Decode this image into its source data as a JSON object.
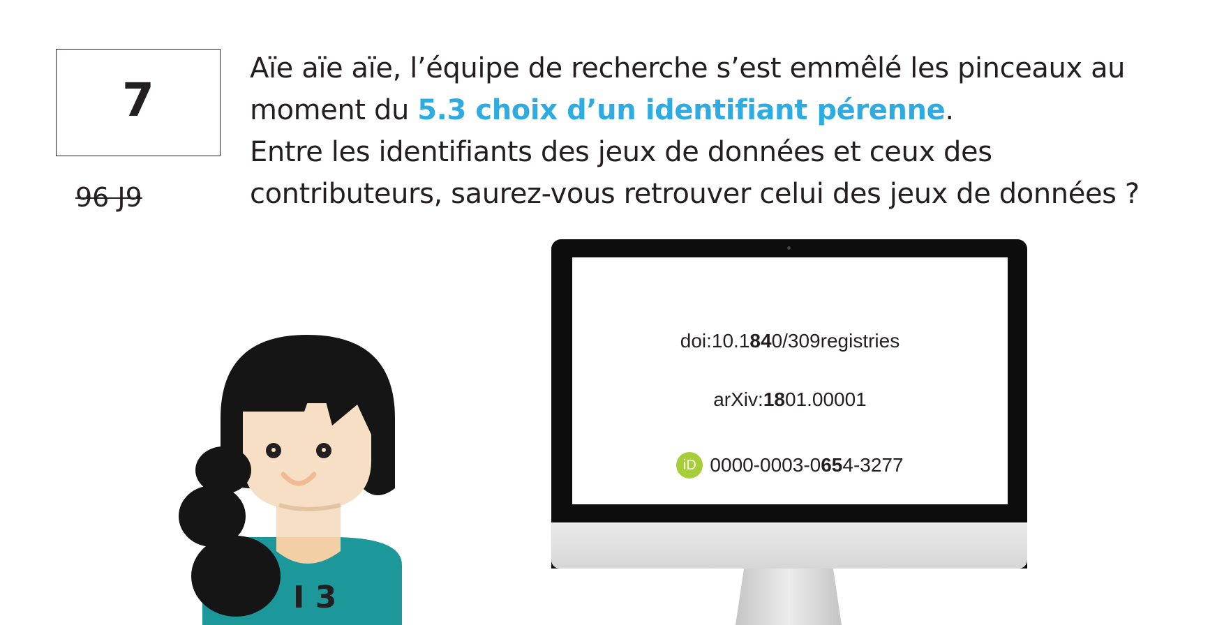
{
  "puzzle": {
    "number": "7",
    "flipped_code": "96 J9"
  },
  "question": {
    "line1": "Aïe aïe aïe, l’équipe de recherche s’est emmêlé les pinceaux au",
    "line2_before": "moment du ",
    "line2_link": "5.3 choix d’un identifiant pérenne",
    "line2_after": ".",
    "line3": "Entre les identifiants des jeux de données et ceux des",
    "line4": "contributeurs, saurez-vous retrouver celui des jeux de données ?"
  },
  "screen": {
    "doi": {
      "prefix": "doi:10.1",
      "bold": "84",
      "suffix": "0/309registries"
    },
    "arxiv": {
      "prefix": "arXiv:",
      "bold": "18",
      "suffix": "01.00001"
    },
    "orcid": {
      "icon_label": "iD",
      "prefix": "0000-0003-0",
      "bold": "65",
      "suffix": "4-3277"
    }
  },
  "character": {
    "shirt_number": "I 3"
  },
  "colors": {
    "accent": "#2eabe0",
    "text": "#231f20",
    "orcid_green": "#a6ce39",
    "shirt_teal": "#1c979a",
    "skin": "#f6dfc4",
    "hair": "#151515"
  },
  "icons": [
    "orcid-icon",
    "woman-illustration",
    "monitor-illustration"
  ]
}
